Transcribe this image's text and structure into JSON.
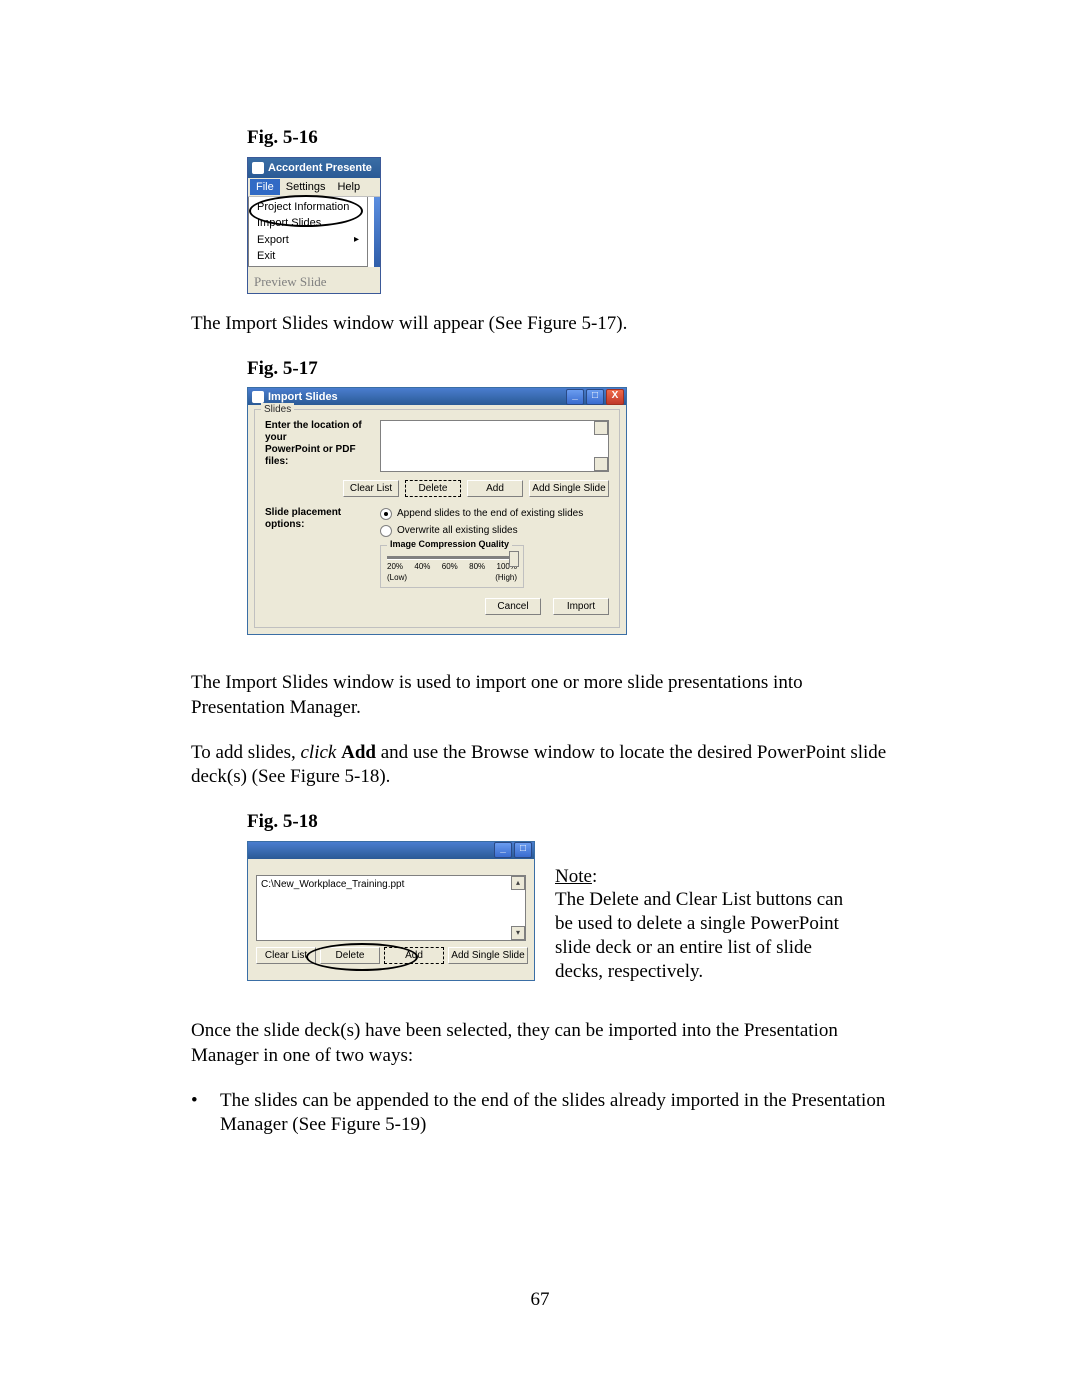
{
  "fig16": {
    "caption": "Fig. 5-16",
    "title": "Accordent Presente",
    "menubar": {
      "file": "File",
      "settings": "Settings",
      "help": "Help"
    },
    "menu": {
      "project_info": "Project Information",
      "import_slides": "Import Slides",
      "export": "Export",
      "exit": "Exit"
    },
    "body_text": "Preview Slide"
  },
  "para1": "The Import Slides window will appear (See Figure 5-17).",
  "fig17": {
    "caption": "Fig. 5-17",
    "title": "Import Slides",
    "group_legend": "Slides",
    "enter_loc_line1": "Enter the location of your",
    "enter_loc_line2": "PowerPoint or PDF files:",
    "btn_clear": "Clear List",
    "btn_delete": "Delete",
    "btn_add": "Add",
    "btn_addsingle": "Add Single Slide",
    "placement_lbl": "Slide placement options:",
    "radio_append": "Append slides to the end of existing slides",
    "radio_overwrite": "Overwrite all existing slides",
    "compress_legend": "Image Compression Quality",
    "ticks": [
      "20%",
      "40%",
      "60%",
      "80%",
      "100%"
    ],
    "ends": [
      "(Low)",
      "(High)"
    ],
    "btn_cancel": "Cancel",
    "btn_import": "Import"
  },
  "para2": "The Import Slides window is used to import one or more slide presentations into Presentation Manager.",
  "para3_a": "To add slides, ",
  "para3_click": "click",
  "para3_b": " ",
  "para3_add": "Add",
  "para3_c": " and use the Browse window to locate the desired PowerPoint slide deck(s) (See Figure 5-18).",
  "fig18": {
    "caption": "Fig. 5-18",
    "file_path": "C:\\New_Workplace_Training.ppt",
    "btn_clear": "Clear List",
    "btn_delete": "Delete",
    "btn_add": "Add",
    "btn_addsingle": "Add Single Slide",
    "note_heading_prefix": "Note",
    "note_body": "The Delete and Clear List buttons can be used to delete a single PowerPoint slide deck or an entire list of slide decks, respectively."
  },
  "para4": "Once the slide deck(s) have been selected, they can be imported into the Presentation Manager in one of two ways:",
  "bullet1": "The slides can be appended to the end of the slides already imported in the Presentation Manager (See Figure 5-19)",
  "page_number": "67"
}
